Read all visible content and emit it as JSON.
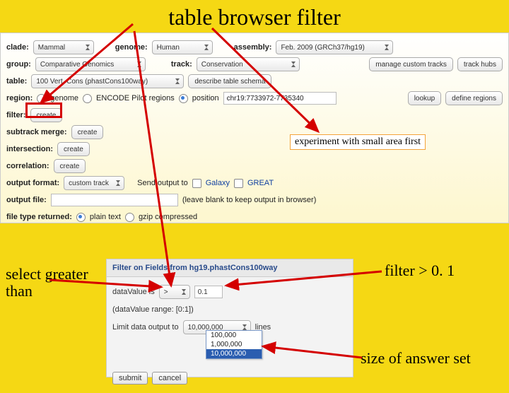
{
  "title": "table browser filter",
  "top": {
    "clade_lbl": "clade:",
    "clade_val": "Mammal",
    "genome_lbl": "genome:",
    "genome_val": "Human",
    "assembly_lbl": "assembly:",
    "assembly_val": "Feb. 2009 (GRCh37/hg19)",
    "group_lbl": "group:",
    "group_val": "Comparative Genomics",
    "track_lbl": "track:",
    "track_val": "Conservation",
    "manage_btn": "manage custom tracks",
    "hubs_btn": "track hubs",
    "table_lbl": "table:",
    "table_val": "100 Vert. Cons (phastCons100way)",
    "describe_btn": "describe table schema",
    "region_lbl": "region:",
    "region_genome": "genome",
    "region_encode": "ENCODE Pilot regions",
    "region_position": "position",
    "position_val": "chr19:7733972-7735340",
    "lookup_btn": "lookup",
    "define_btn": "define regions",
    "filter_lbl": "filter:",
    "filter_btn": "create",
    "subtrack_lbl": "subtrack merge:",
    "subtrack_btn": "create",
    "intersection_lbl": "intersection:",
    "intersection_btn": "create",
    "correlation_lbl": "correlation:",
    "correlation_btn": "create",
    "outfmt_lbl": "output format:",
    "outfmt_val": "custom track",
    "sendto_lbl": "Send output to",
    "galaxy_lbl": "Galaxy",
    "great_lbl": "GREAT",
    "outfile_lbl": "output file:",
    "outfile_hint": "(leave blank to keep output in browser)",
    "ftype_lbl": "file type returned:",
    "ftype_plain": "plain text",
    "ftype_gzip": "gzip compressed"
  },
  "callout": "experiment with small area first",
  "left_ann": "select greater than",
  "right_ann1": "filter > 0. 1",
  "right_ann2": "size of answer set",
  "filter": {
    "header": "Filter on Fields from hg19.phastCons100way",
    "dv_lbl": "dataValue is",
    "dv_op": ">",
    "dv_val": "0.1",
    "range": "(dataValue range: [0:1])",
    "limit_lbl": "Limit data output to",
    "limit_val": "10,000,000",
    "limit_lines": "lines",
    "opts": [
      "100,000",
      "1,000,000",
      "10,000,000"
    ],
    "submit": "submit",
    "cancel": "cancel"
  }
}
